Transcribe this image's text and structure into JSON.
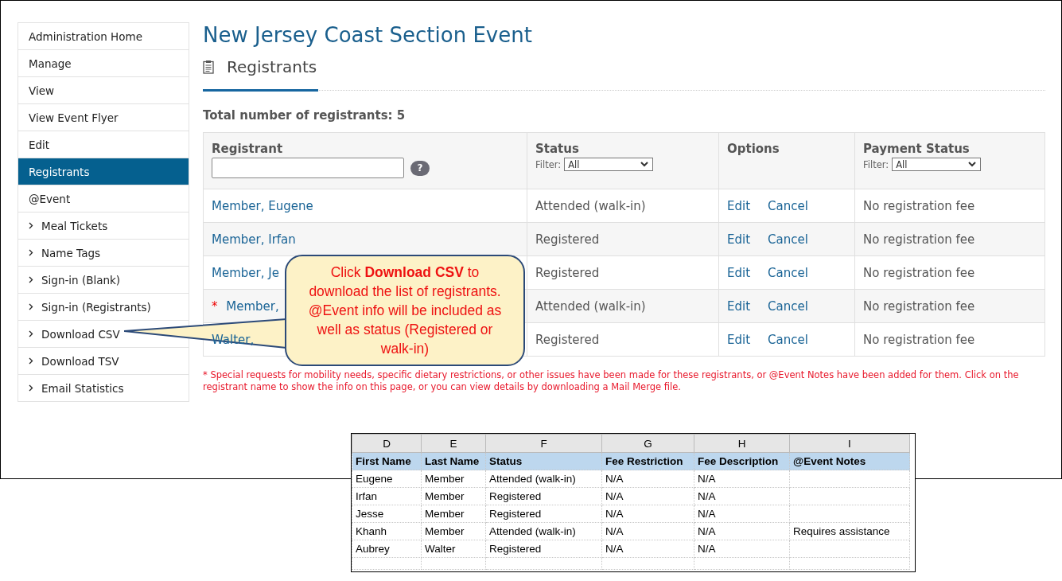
{
  "page_title": "New Jersey Coast Section Event",
  "section": {
    "title": "Registrants"
  },
  "sidebar": {
    "items": [
      {
        "label": "Administration Home",
        "kind": "link",
        "selected": false
      },
      {
        "label": "Manage",
        "kind": "link",
        "selected": false
      },
      {
        "label": "View",
        "kind": "link",
        "selected": false
      },
      {
        "label": "View Event Flyer",
        "kind": "link",
        "selected": false
      },
      {
        "label": "Edit",
        "kind": "link",
        "selected": false
      },
      {
        "label": "Registrants",
        "kind": "link",
        "selected": true
      },
      {
        "label": "@Event",
        "kind": "link",
        "selected": false
      },
      {
        "label": "Meal Tickets",
        "kind": "sub",
        "selected": false
      },
      {
        "label": "Name Tags",
        "kind": "sub",
        "selected": false
      },
      {
        "label": "Sign-in (Blank)",
        "kind": "sub",
        "selected": false
      },
      {
        "label": "Sign-in (Registrants)",
        "kind": "sub",
        "selected": false
      },
      {
        "label": "Download CSV",
        "kind": "sub",
        "selected": false
      },
      {
        "label": "Download TSV",
        "kind": "sub",
        "selected": false
      },
      {
        "label": "Email Statistics",
        "kind": "sub",
        "selected": false
      }
    ]
  },
  "total": "Total number of registrants: 5",
  "table": {
    "columns": [
      {
        "label": "Registrant",
        "kind": "search",
        "help": "?"
      },
      {
        "label": "Status",
        "kind": "filter",
        "filter_label": "Filter:",
        "filter_value": "All"
      },
      {
        "label": "Options",
        "kind": "plain"
      },
      {
        "label": "Payment Status",
        "kind": "filter",
        "filter_label": "Filter:",
        "filter_value": "All"
      }
    ],
    "flag_mark": "*",
    "rows": [
      {
        "registrant": "Member, Eugene",
        "flagged": false,
        "status": "Attended (walk-in)",
        "options": [
          "Edit",
          "Cancel"
        ],
        "payment": "No registration fee"
      },
      {
        "registrant": "Member, Irfan",
        "flagged": false,
        "status": "Registered",
        "options": [
          "Edit",
          "Cancel"
        ],
        "payment": "No registration fee"
      },
      {
        "registrant": "Member, Je",
        "flagged": false,
        "status": "Registered",
        "options": [
          "Edit",
          "Cancel"
        ],
        "payment": "No registration fee"
      },
      {
        "registrant": "Member, ",
        "flagged": true,
        "status": "Attended (walk-in)",
        "options": [
          "Edit",
          "Cancel"
        ],
        "payment": "No registration fee"
      },
      {
        "registrant": "Walter,",
        "flagged": false,
        "status": "Registered",
        "options": [
          "Edit",
          "Cancel"
        ],
        "payment": "No registration fee"
      }
    ]
  },
  "note": "* Special requests for mobility needs, specific dietary restrictions, or other issues have been made for these registrants, or @Event Notes have been added for them. Click on the registrant name to show the info on this page, or you can view details by downloading a Mail Merge file.",
  "callout": {
    "text": "Click **Download CSV** to download the list of registrants. @Event info will be included as well as status (Registered or walk-in)"
  },
  "spreadsheet": {
    "column_letters": [
      "D",
      "E",
      "F",
      "G",
      "H",
      "I"
    ],
    "headers": [
      "First Name",
      "Last Name",
      "Status",
      "Fee Restriction",
      "Fee Description",
      "@Event Notes"
    ],
    "rows": [
      [
        "Eugene",
        "Member",
        "Attended (walk-in)",
        "N/A",
        "N/A",
        ""
      ],
      [
        "Irfan",
        "Member",
        "Registered",
        "N/A",
        "N/A",
        ""
      ],
      [
        "Jesse",
        "Member",
        "Registered",
        "N/A",
        "N/A",
        ""
      ],
      [
        "Khanh",
        "Member",
        "Attended (walk-in)",
        "N/A",
        "N/A",
        "Requires assistance"
      ],
      [
        "Aubrey",
        "Walter",
        "Registered",
        "N/A",
        "N/A",
        ""
      ]
    ]
  }
}
